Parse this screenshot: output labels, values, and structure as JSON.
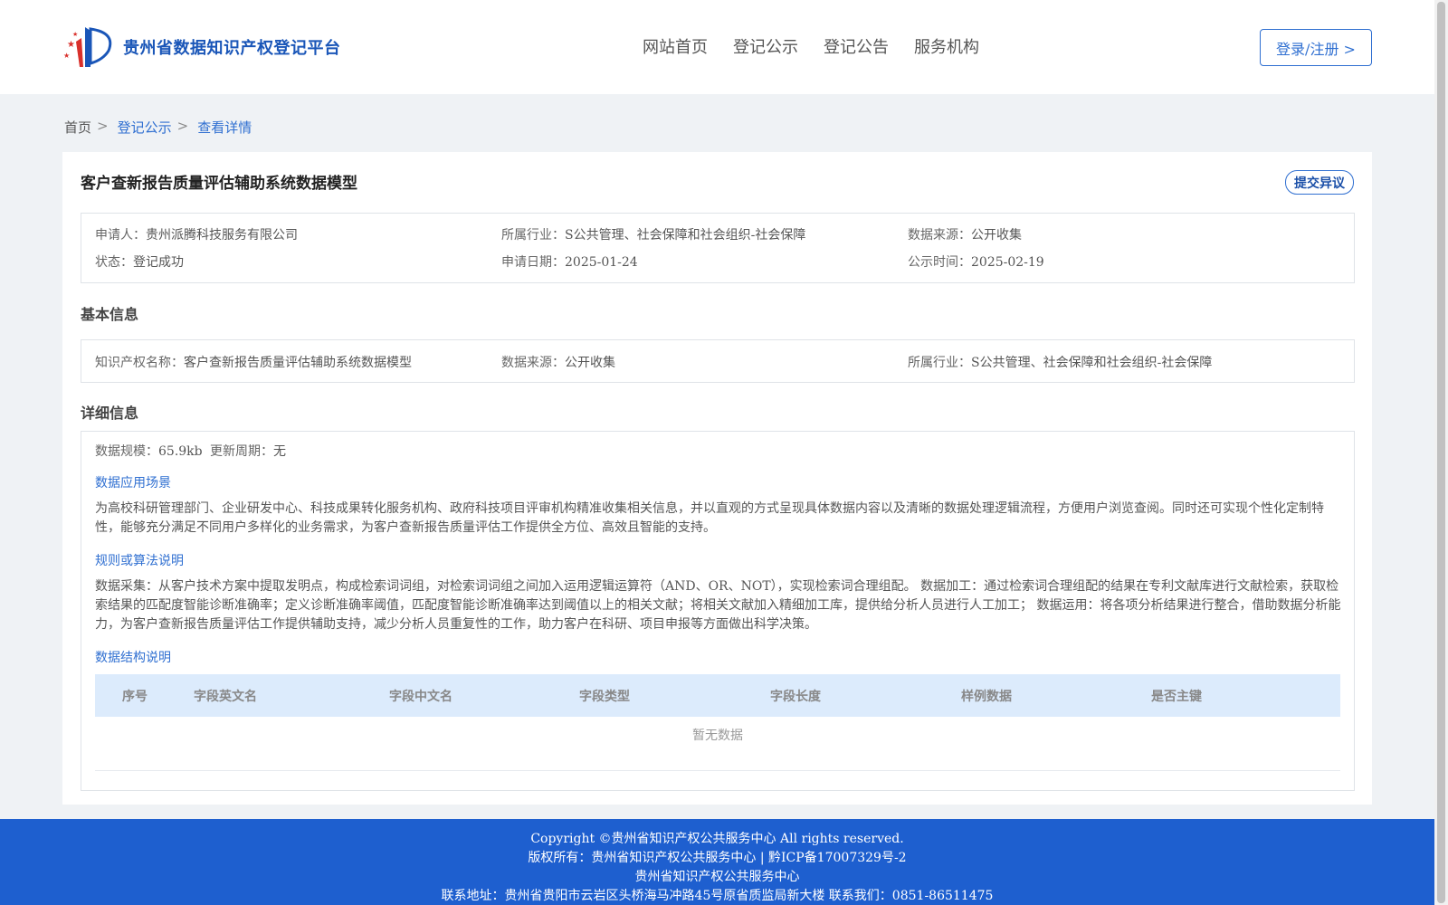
{
  "header": {
    "site_title": "贵州省数据知识产权登记平台",
    "nav": [
      "网站首页",
      "登记公示",
      "登记公告",
      "服务机构"
    ],
    "login_label": "登录/注册 >",
    "logo_icon": "flag-logo-icon"
  },
  "breadcrumb": {
    "home": "首页",
    "sep": ">",
    "level1": "登记公示",
    "level2": "查看详情"
  },
  "record": {
    "title": "客户查新报告质量评估辅助系统数据模型",
    "objection_label": "提交异议",
    "summary": {
      "applicant_label": "申请人：",
      "applicant": "贵州派腾科技服务有限公司",
      "industry_label": "所属行业：",
      "industry": "S公共管理、社会保障和社会组织-社会保障",
      "source_label": "数据来源：",
      "source": "公开收集",
      "status_label": "状态：",
      "status": "登记成功",
      "apply_date_label": "申请日期：",
      "apply_date": "2025-01-24",
      "publish_time_label": "公示时间：",
      "publish_time": "2025-02-19"
    },
    "basic": {
      "section_title": "基本信息",
      "ip_name_label": "知识产权名称：",
      "ip_name": "客户查新报告质量评估辅助系统数据模型",
      "source_label": "数据来源：",
      "source": "公开收集",
      "industry_label": "所属行业：",
      "industry": "S公共管理、社会保障和社会组织-社会保障"
    },
    "detail": {
      "section_title": "详细信息",
      "scale_label": "数据规模：",
      "scale": "65.9kb",
      "cycle_label": "更新周期：",
      "cycle": "无",
      "scenario_title": "数据应用场景",
      "scenario_text": "为高校科研管理部门、企业研发中心、科技成果转化服务机构、政府科技项目评审机构精准收集相关信息，并以直观的方式呈现具体数据内容以及清晰的数据处理逻辑流程，方便用户浏览查阅。同时还可实现个性化定制特性，能够充分满足不同用户多样化的业务需求，为客户查新报告质量评估工作提供全方位、高效且智能的支持。",
      "rules_title": "规则或算法说明",
      "rules_text": "数据采集：从客户技术方案中提取发明点，构成检索词词组，对检索词词组之间加入运用逻辑运算符（AND、OR、NOT），实现检索词合理组配。 数据加工：通过检索词合理组配的结果在专利文献库进行文献检索，获取检索结果的匹配度智能诊断准确率；定义诊断准确率阈值，匹配度智能诊断准确率达到阈值以上的相关文献；将相关文献加入精细加工库，提供给分析人员进行人工加工； 数据运用：将各项分析结果进行整合，借助数据分析能力，为客户查新报告质量评估工作提供辅助支持，减少分析人员重复性的工作，助力客户在科研、项目申报等方面做出科学决策。",
      "structure_title": "数据结构说明",
      "table_headers": [
        "序号",
        "字段英文名",
        "字段中文名",
        "字段类型",
        "字段长度",
        "样例数据",
        "是否主键"
      ],
      "empty_text": "暂无数据"
    }
  },
  "footer": {
    "copyright": "Copyright ©贵州省知识产权公共服务中心 All rights reserved.",
    "owner": "版权所有：贵州省知识产权公共服务中心 | 黔ICP备17007329号-2",
    "org": "贵州省知识产权公共服务中心",
    "contact": "联系地址：贵州省贵阳市云岩区头桥海马冲路45号原省质监局新大楼 联系我们：0851-86511475"
  },
  "colors": {
    "primary": "#2f6fd1",
    "footer_bg": "#1e5fcf",
    "page_bg": "#eff2f5",
    "table_head_bg": "#dcebfc"
  }
}
